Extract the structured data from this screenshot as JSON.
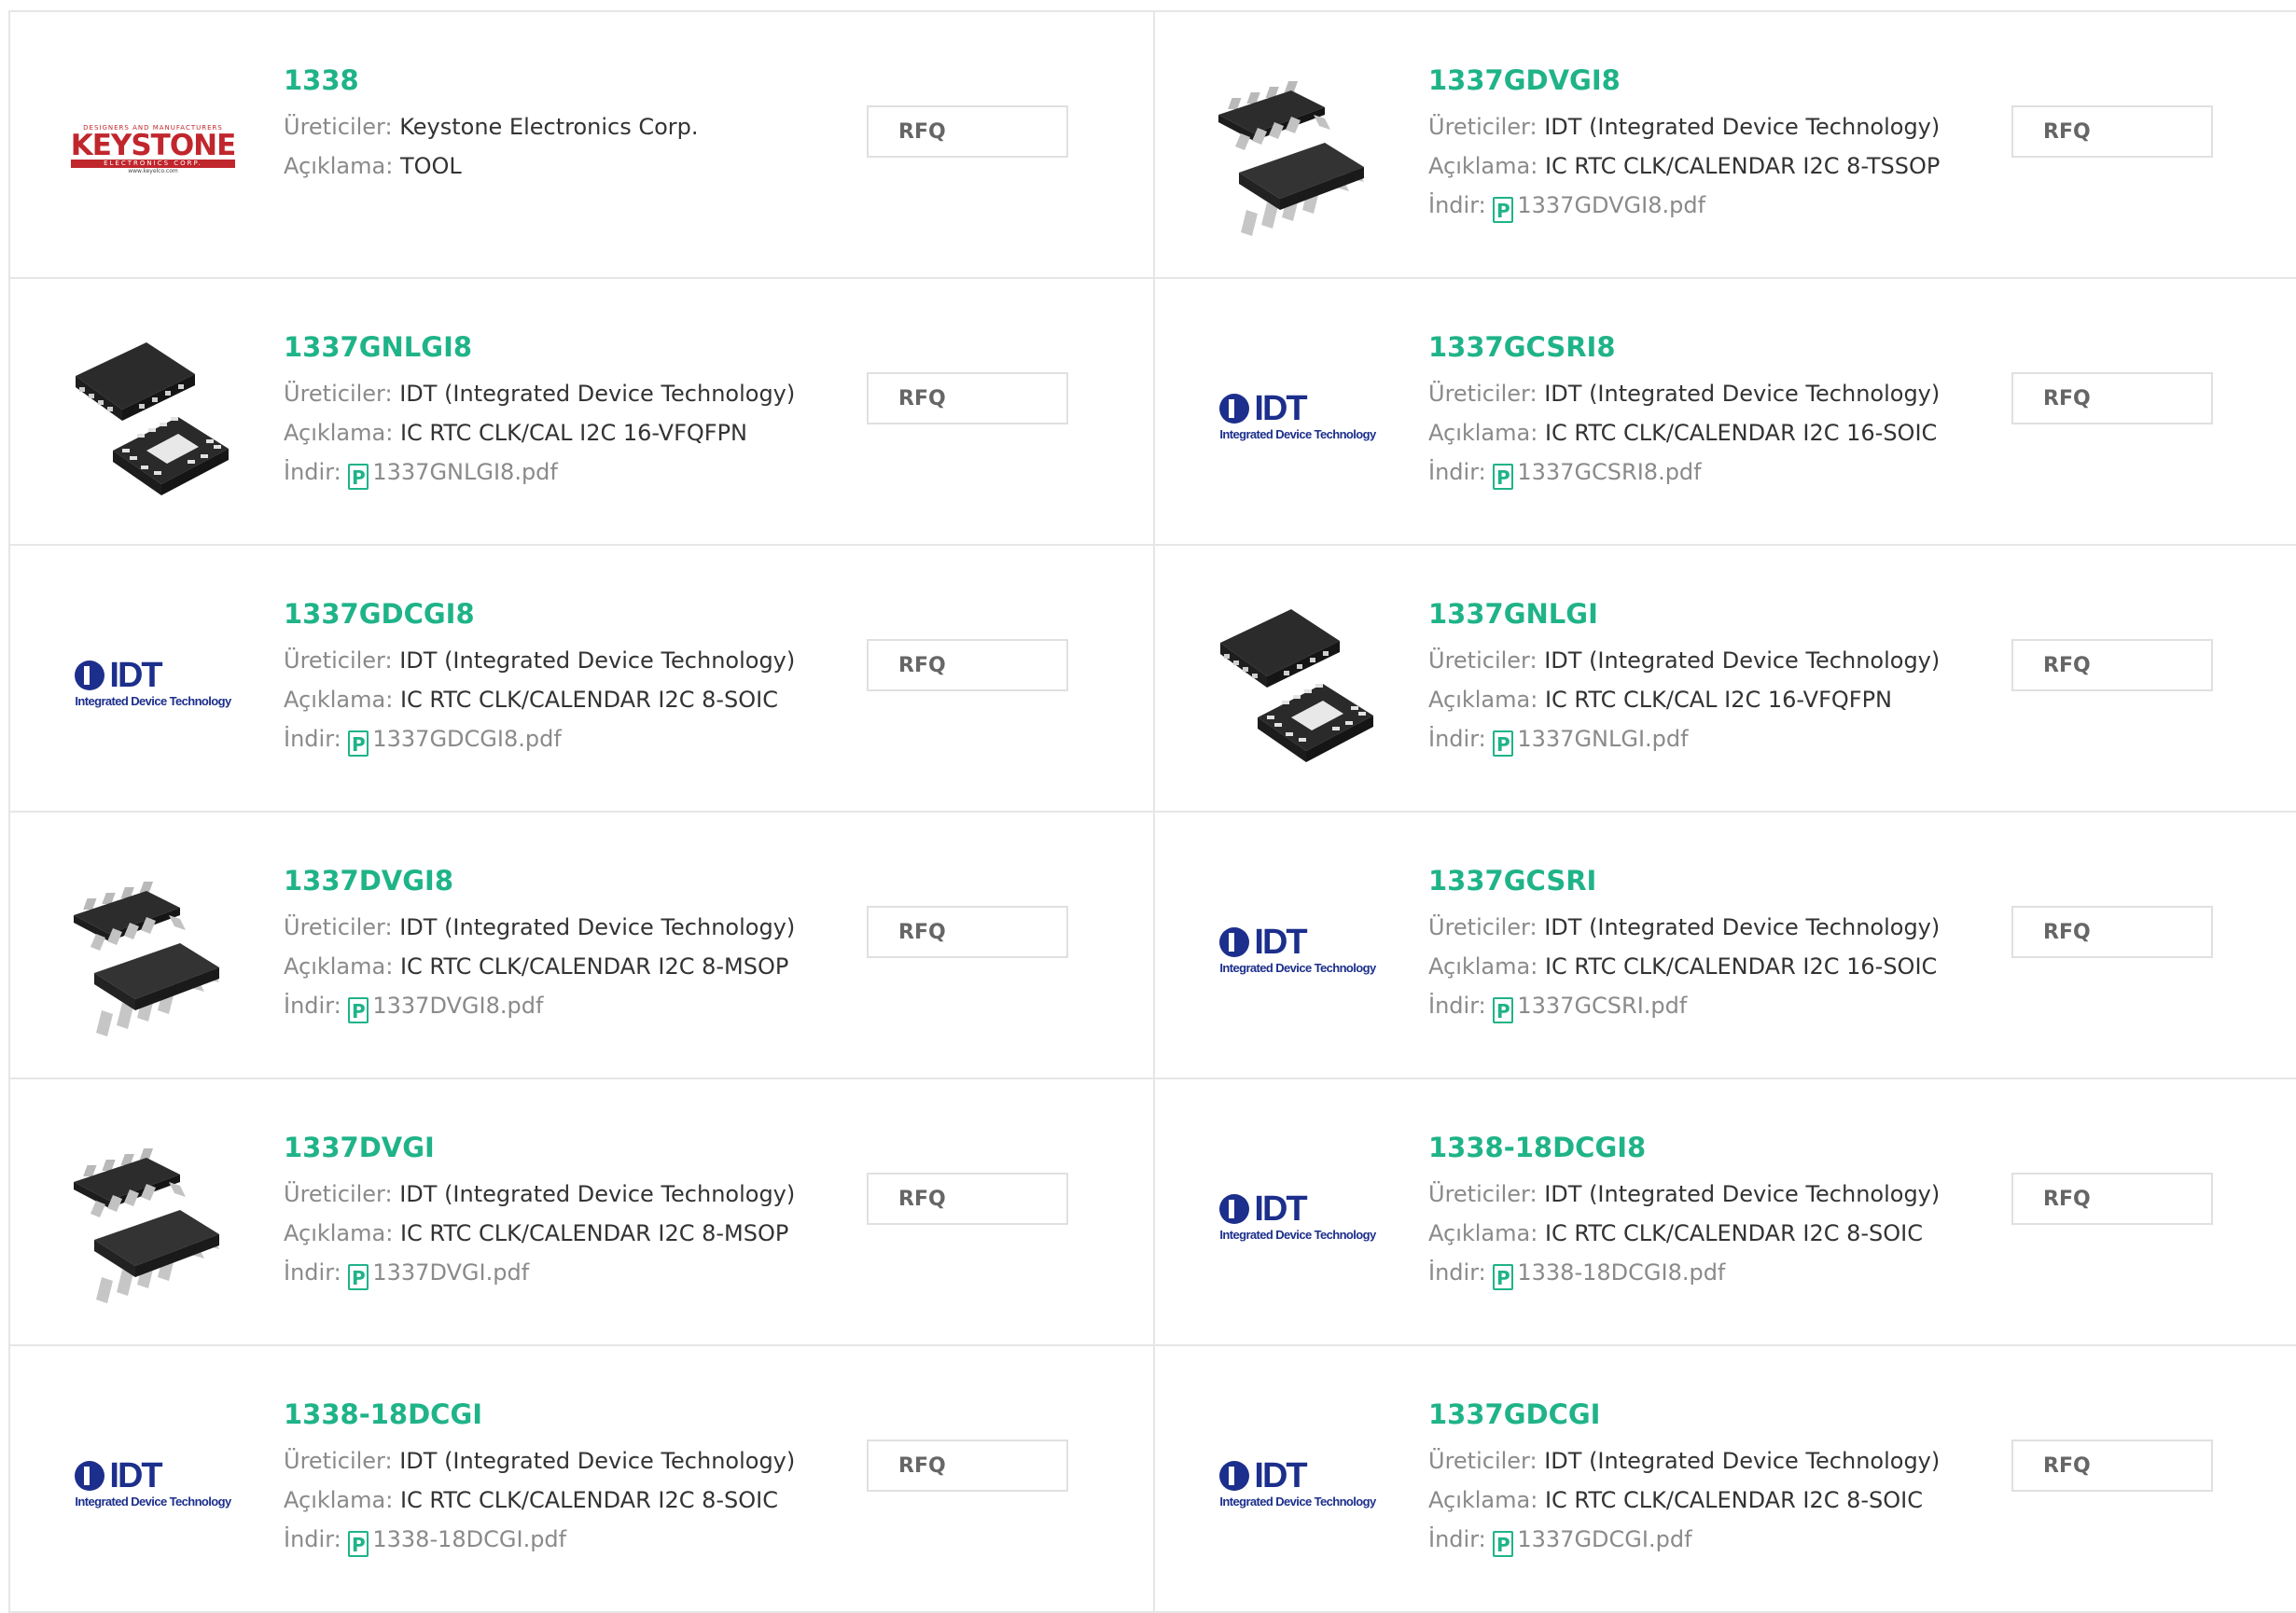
{
  "labels": {
    "manufacturer": "Üreticiler:",
    "description": "Açıklama:",
    "download": "İndir:",
    "rfq": "RFQ",
    "pdf_glyph": "P"
  },
  "logos": {
    "keystone": {
      "tagline": "DESIGNERS AND MANUFACTURERS",
      "name": "KEYSTONE",
      "bar": "ELECTRONICS CORP.",
      "url": "www.keyelco.com"
    },
    "idt": {
      "name": "IDT",
      "subtitle": "Integrated Device Technology"
    }
  },
  "products": [
    {
      "part": "1338",
      "manufacturer": "Keystone Electronics Corp.",
      "description": "TOOL",
      "pdf": "",
      "image": "keystone-logo"
    },
    {
      "part": "1337GDVGI8",
      "manufacturer": "IDT (Integrated Device Technology)",
      "description": "IC RTC CLK/CALENDAR I2C 8-TSSOP",
      "pdf": "1337GDVGI8.pdf",
      "image": "msop-chip"
    },
    {
      "part": "1337GNLGI8",
      "manufacturer": "IDT (Integrated Device Technology)",
      "description": "IC RTC CLK/CAL I2C 16-VFQFPN",
      "pdf": "1337GNLGI8.pdf",
      "image": "qfn-chip"
    },
    {
      "part": "1337GCSRI8",
      "manufacturer": "IDT (Integrated Device Technology)",
      "description": "IC RTC CLK/CALENDAR I2C 16-SOIC",
      "pdf": "1337GCSRI8.pdf",
      "image": "idt-logo"
    },
    {
      "part": "1337GDCGI8",
      "manufacturer": "IDT (Integrated Device Technology)",
      "description": "IC RTC CLK/CALENDAR I2C 8-SOIC",
      "pdf": "1337GDCGI8.pdf",
      "image": "idt-logo"
    },
    {
      "part": "1337GNLGI",
      "manufacturer": "IDT (Integrated Device Technology)",
      "description": "IC RTC CLK/CAL I2C 16-VFQFPN",
      "pdf": "1337GNLGI.pdf",
      "image": "qfn-chip"
    },
    {
      "part": "1337DVGI8",
      "manufacturer": "IDT (Integrated Device Technology)",
      "description": "IC RTC CLK/CALENDAR I2C 8-MSOP",
      "pdf": "1337DVGI8.pdf",
      "image": "msop-chip"
    },
    {
      "part": "1337GCSRI",
      "manufacturer": "IDT (Integrated Device Technology)",
      "description": "IC RTC CLK/CALENDAR I2C 16-SOIC",
      "pdf": "1337GCSRI.pdf",
      "image": "idt-logo"
    },
    {
      "part": "1337DVGI",
      "manufacturer": "IDT (Integrated Device Technology)",
      "description": "IC RTC CLK/CALENDAR I2C 8-MSOP",
      "pdf": "1337DVGI.pdf",
      "image": "msop-chip"
    },
    {
      "part": "1338-18DCGI8",
      "manufacturer": "IDT (Integrated Device Technology)",
      "description": "IC RTC CLK/CALENDAR I2C 8-SOIC",
      "pdf": "1338-18DCGI8.pdf",
      "image": "idt-logo"
    },
    {
      "part": "1338-18DCGI",
      "manufacturer": "IDT (Integrated Device Technology)",
      "description": "IC RTC CLK/CALENDAR I2C 8-SOIC",
      "pdf": "1338-18DCGI.pdf",
      "image": "idt-logo"
    },
    {
      "part": "1337GDCGI",
      "manufacturer": "IDT (Integrated Device Technology)",
      "description": "IC RTC CLK/CALENDAR I2C 8-SOIC",
      "pdf": "1337GDCGI.pdf",
      "image": "idt-logo"
    }
  ],
  "colors": {
    "accent_green": "#1fb388",
    "label_gray": "#8a8a8a",
    "border": "#e6e6e6",
    "keystone_red": "#c0272d",
    "idt_blue": "#1c2f8c"
  }
}
